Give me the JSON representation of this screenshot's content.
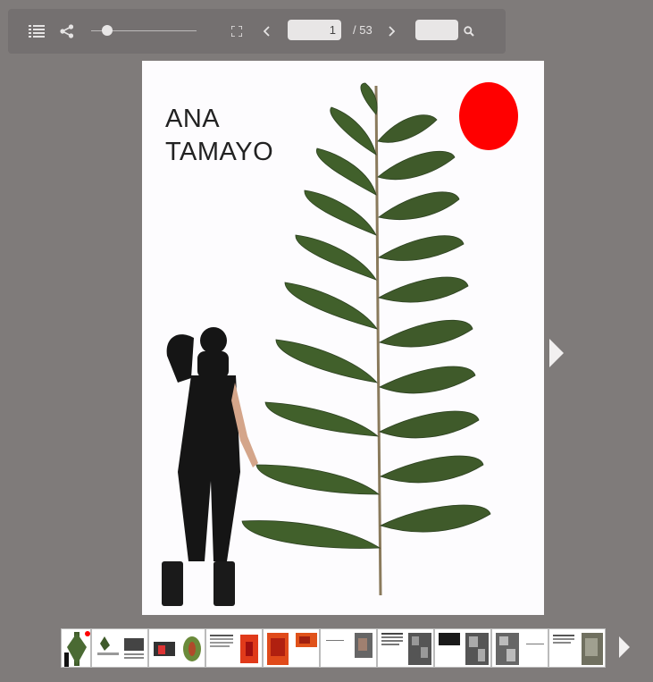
{
  "toolbar": {
    "icons": [
      "list-icon",
      "share-icon",
      "fullscreen-icon",
      "chevron-left-icon",
      "chevron-right-icon",
      "search-icon"
    ],
    "page_input_value": "1",
    "page_total": "/ 53",
    "zoom_slider_level": 0.16,
    "search_value": ""
  },
  "page": {
    "title_line1": "ANA",
    "title_line2": "TAMAYO",
    "sun_color": "#ff0000"
  },
  "thumbnails": {
    "count_visible": 10
  },
  "colors": {
    "background": "#7f7b7a",
    "toolbar": "#747070",
    "page": "#fdfcfe",
    "accent_red": "#ff0000",
    "leaf_green": "#3f5a2a"
  }
}
